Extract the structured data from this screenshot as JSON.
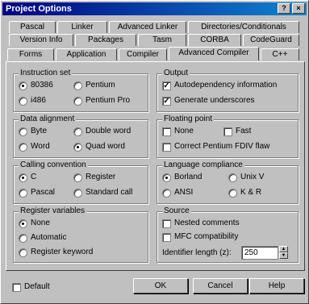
{
  "window": {
    "title": "Project Options"
  },
  "title_buttons": {
    "help": "?",
    "close": "×"
  },
  "tabs": {
    "row1": [
      "Pascal",
      "Linker",
      "Advanced Linker",
      "Directories/Conditionals"
    ],
    "row2": [
      "Version Info",
      "Packages",
      "Tasm",
      "CORBA",
      "CodeGuard"
    ],
    "row3": [
      "Forms",
      "Application",
      "Compiler",
      "Advanced Compiler",
      "C++"
    ],
    "active": "Advanced Compiler"
  },
  "instruction_set": {
    "title": "Instruction set",
    "options": [
      "80386",
      "i486",
      "Pentium",
      "Pentium Pro"
    ],
    "selected": "80386"
  },
  "data_alignment": {
    "title": "Data alignment",
    "options": [
      "Byte",
      "Word",
      "Double word",
      "Quad word"
    ],
    "selected": "Quad word"
  },
  "calling_convention": {
    "title": "Calling convention",
    "options": [
      "C",
      "Pascal",
      "Register",
      "Standard call"
    ],
    "selected": "C"
  },
  "register_variables": {
    "title": "Register variables",
    "options": [
      "None",
      "Automatic",
      "Register keyword"
    ],
    "selected": "None"
  },
  "output": {
    "title": "Output",
    "autodep": "Autodependency information",
    "autodep_checked": "✓",
    "underscores": "Generate underscores",
    "underscores_checked": "✓"
  },
  "floating_point": {
    "title": "Floating point",
    "none": "None",
    "fast": "Fast",
    "fdiv": "Correct Pentium FDIV flaw"
  },
  "language_compliance": {
    "title": "Language compliance",
    "options": [
      "Borland",
      "ANSI",
      "Unix V",
      "K & R"
    ],
    "selected": "Borland"
  },
  "source": {
    "title": "Source",
    "nested": "Nested comments",
    "mfc": "MFC compatibility",
    "ident_label": "Identifier length (z):",
    "ident_value": "250"
  },
  "footer": {
    "default": "Default",
    "ok": "OK",
    "cancel": "Cancel",
    "help": "Help"
  }
}
